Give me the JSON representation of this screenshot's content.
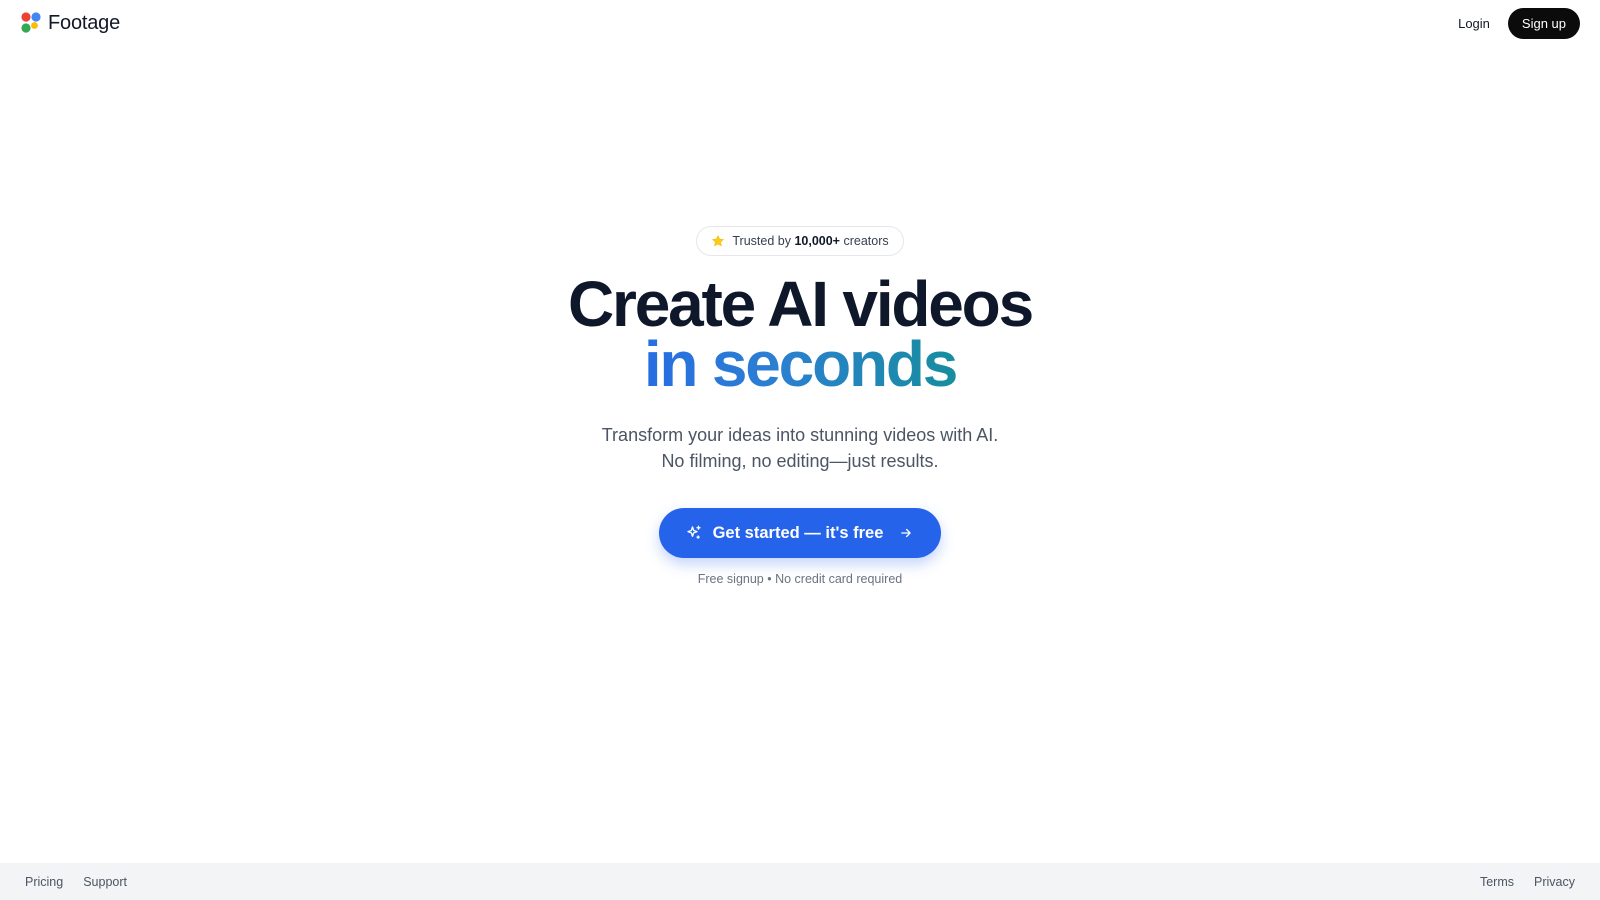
{
  "brand": {
    "name": "Footage",
    "logo_colors": [
      "#ea4335",
      "#4285f4",
      "#34a853",
      "#fbbc05"
    ]
  },
  "header": {
    "login_label": "Login",
    "signup_label": "Sign up"
  },
  "hero": {
    "trust_prefix": "Trusted by",
    "trust_count": "10,000+",
    "trust_suffix": "creators",
    "trust_icon": "star-icon",
    "headline_line1": "Create AI videos",
    "headline_line2": "in seconds",
    "subtitle_line1": "Transform your ideas into stunning videos with AI.",
    "subtitle_line2": "No filming, no editing—just results.",
    "cta_label": "Get started — it's free",
    "cta_icons": [
      "sparkles-icon",
      "arrow-right-icon"
    ],
    "cta_note": "Free signup • No credit card required"
  },
  "footer": {
    "left_links": [
      "Pricing",
      "Support"
    ],
    "right_links": [
      "Terms",
      "Privacy"
    ]
  },
  "colors": {
    "accent": "#2563eb",
    "gradient_end": "#0d9488",
    "star": "#facc15",
    "signup_bg": "#0b0b0b",
    "footer_bg": "#f3f4f6"
  }
}
